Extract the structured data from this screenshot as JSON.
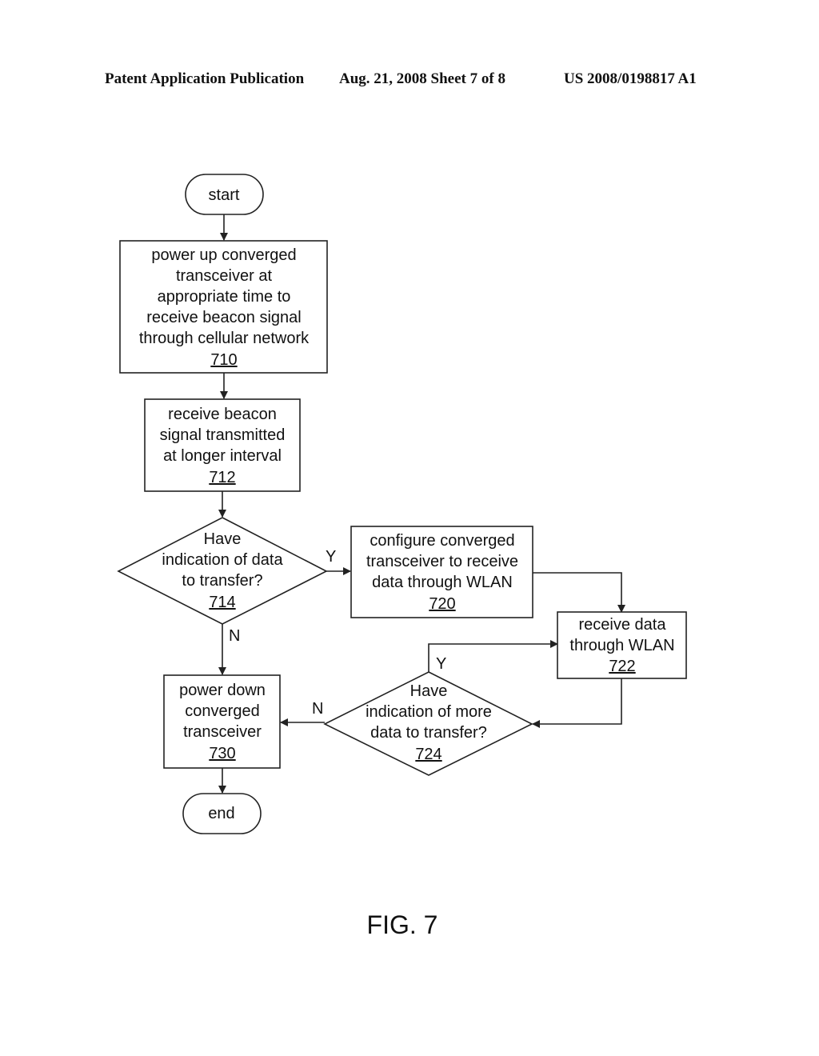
{
  "header": {
    "left": "Patent Application Publication",
    "middle": "Aug. 21, 2008  Sheet 7 of 8",
    "right": "US 2008/0198817 A1"
  },
  "figure_label": "FIG. 7",
  "nodes": {
    "start": {
      "lines": [
        "start"
      ],
      "ref": ""
    },
    "n710": {
      "lines": [
        "power up converged",
        "transceiver at",
        "appropriate time to",
        "receive beacon signal",
        "through cellular network"
      ],
      "ref": "710"
    },
    "n712": {
      "lines": [
        "receive beacon",
        "signal transmitted",
        "at longer interval"
      ],
      "ref": "712"
    },
    "n714": {
      "lines": [
        "Have",
        "indication of data",
        "to transfer?"
      ],
      "ref": "714"
    },
    "n720": {
      "lines": [
        "configure converged",
        "transceiver to receive",
        "data through WLAN"
      ],
      "ref": "720"
    },
    "n722": {
      "lines": [
        "receive data",
        "through WLAN"
      ],
      "ref": "722"
    },
    "n724": {
      "lines": [
        "Have",
        "indication of more",
        "data to transfer?"
      ],
      "ref": "724"
    },
    "n730": {
      "lines": [
        "power down",
        "converged",
        "transceiver"
      ],
      "ref": "730"
    },
    "end": {
      "lines": [
        "end"
      ],
      "ref": ""
    }
  },
  "edge_labels": {
    "d714_yes": "Y",
    "d714_no": "N",
    "d724_yes": "Y",
    "d724_no": "N"
  }
}
